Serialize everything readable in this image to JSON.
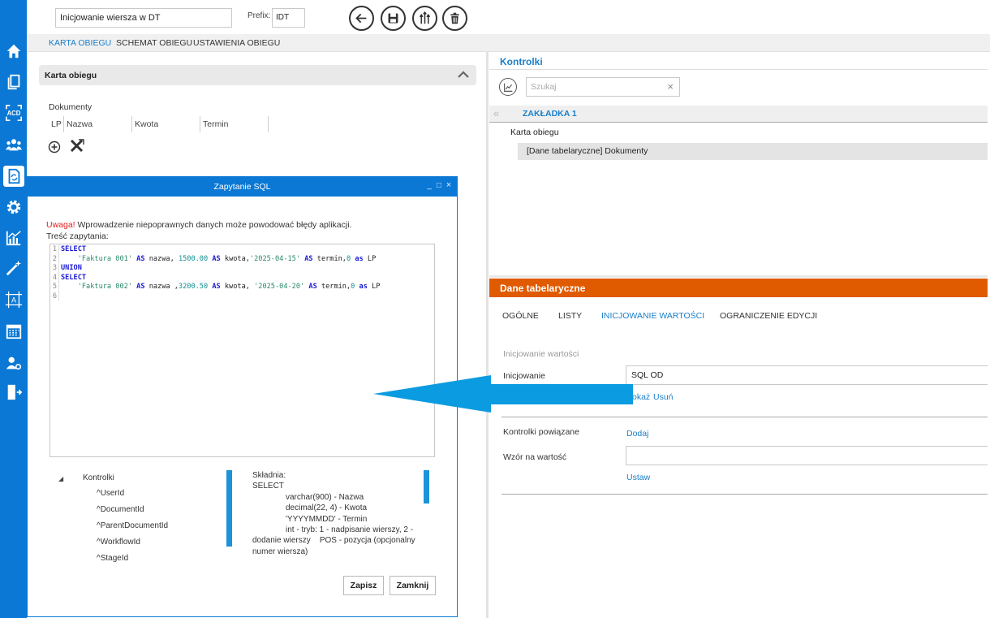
{
  "header": {
    "name_value": "Inicjowanie wiersza  w DT",
    "prefix_label": "Prefix:",
    "prefix_value": "IDT"
  },
  "toolbar": {
    "back_icon": "arrow-left-icon",
    "save_icon": "save-icon",
    "split_icon": "split-arrows-icon",
    "delete_icon": "trash-icon"
  },
  "nav": {
    "tabs": [
      {
        "label": "KARTA OBIEGU",
        "active": true
      },
      {
        "label": "SCHEMAT OBIEGU",
        "active": false
      },
      {
        "label": "USTAWIENIA OBIEGU",
        "active": false
      }
    ]
  },
  "card": {
    "title": "Karta obiegu",
    "documents_label": "Dokumenty",
    "columns": [
      "LP",
      "Nazwa",
      "Kwota",
      "Termin"
    ]
  },
  "kontrolki": {
    "title": "Kontrolki",
    "search_placeholder": "Szukaj",
    "search_clear": "×",
    "tab_chevron": "«",
    "tab_label": "ZAKŁADKA 1",
    "tree_root": "Karta obiegu",
    "tree_child": "[Dane tabelaryczne] Dokumenty"
  },
  "dane": {
    "title": "Dane tabelaryczne",
    "tabs": [
      {
        "label": "OGÓLNE",
        "active": false
      },
      {
        "label": "LISTY",
        "active": false
      },
      {
        "label": "INICJOWANIE WARTOŚCI",
        "active": true
      },
      {
        "label": "OGRANICZENIE EDYCJI",
        "active": false
      }
    ],
    "section_label": "Inicjowanie wartości",
    "init_label": "Inicjowanie",
    "init_value": "SQL OD",
    "show_link": "Pokaż",
    "remove_link": "Usuń",
    "related_label": "Kontrolki powiązane",
    "add_link": "Dodaj",
    "pattern_label": "Wzór na wartość",
    "pattern_value": "",
    "set_link": "Ustaw"
  },
  "modal": {
    "title": "Zapytanie SQL",
    "ctrl_min": "_",
    "ctrl_max": "□",
    "ctrl_close": "×",
    "warning_prefix": "Uwaga!",
    "warning_text": " Wprowadzenie niepoprawnych danych może powodować błędy aplikacji.",
    "query_label": "Treść zapytania:",
    "code": {
      "l1": "SELECT",
      "l2_str1": "'Faktura 001'",
      "l2_as1": "AS",
      "l2_id1": "nazwa,",
      "l2_num1": "1500.00",
      "l2_as2": "AS",
      "l2_id2": "kwota,",
      "l2_str2": "'2025-04-15'",
      "l2_as3": "AS",
      "l2_id3": "termin,",
      "l2_num2": "0",
      "l2_as4": "as",
      "l2_id4": "LP",
      "l3": "UNION",
      "l4": "SELECT",
      "l5_str1": "'Faktura 002'",
      "l5_as1": "AS",
      "l5_id1": "nazwa ,",
      "l5_num1": "3200.50",
      "l5_as2": "AS",
      "l5_id2": "kwota,",
      "l5_str2": "'2025-04-20'",
      "l5_as3": "AS",
      "l5_id3": "termin,",
      "l5_num2": "0",
      "l5_as4": "as",
      "l5_id4": "LP",
      "line_numbers": [
        "1",
        "2",
        "3",
        "4",
        "5",
        "6"
      ]
    },
    "tree": {
      "arrow": "◢",
      "root": "Kontrolki",
      "items": [
        "^UserId",
        "^DocumentId",
        "^ParentDocumentId",
        "^WorkflowId",
        "^StageId"
      ]
    },
    "syntax": {
      "title": "Składnia:",
      "select": "SELECT",
      "l1": "varchar(900) - Nazwa",
      "l2": "decimal(22, 4) - Kwota",
      "l3": "'YYYYMMDD' - Termin",
      "l4": "int - tryb: 1 - nadpisanie wierszy, 2 -",
      "l5": "dodanie wierszy    POS - pozycja (opcjonalny",
      "l6": "numer wiersza)"
    },
    "save_button": "Zapisz",
    "close_button": "Zamknij"
  },
  "colors": {
    "sidebar": "#0a78d4",
    "accent": "#1a7fc9",
    "orange": "#e05a00",
    "arrow": "#0b9be0"
  }
}
